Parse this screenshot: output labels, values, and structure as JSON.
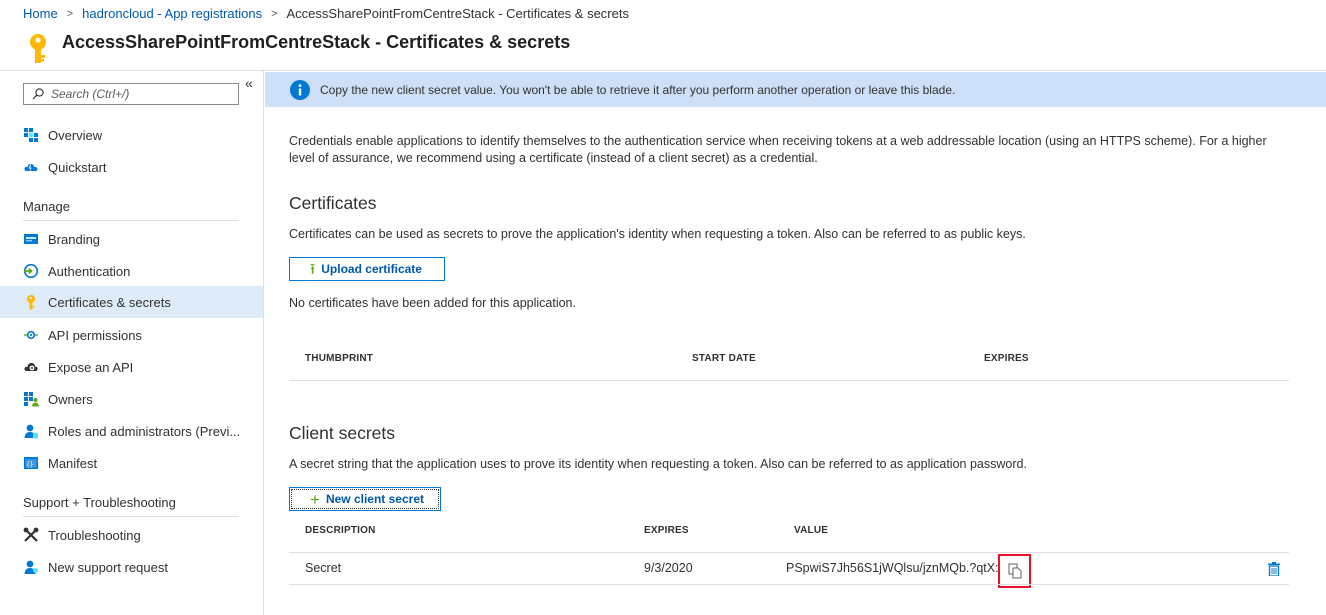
{
  "breadcrumb": {
    "home": "Home",
    "parent": "hadroncloud - App registrations",
    "current": "AccessSharePointFromCentreStack - Certificates & secrets"
  },
  "header": {
    "title": "AccessSharePointFromCentreStack - Certificates & secrets",
    "icon": "key-icon"
  },
  "sidebar": {
    "collapse_glyph": "«",
    "search_placeholder": "Search (Ctrl+/)",
    "items": [
      {
        "label": "Overview",
        "icon": "grid-icon"
      },
      {
        "label": "Quickstart",
        "icon": "cloud-icon"
      }
    ],
    "manage": {
      "heading": "Manage",
      "items": [
        {
          "label": "Branding",
          "icon": "branding-icon"
        },
        {
          "label": "Authentication",
          "icon": "authentication-icon"
        },
        {
          "label": "Certificates & secrets",
          "icon": "key-icon",
          "active": true
        },
        {
          "label": "API permissions",
          "icon": "api-permissions-icon"
        },
        {
          "label": "Expose an API",
          "icon": "cloud-gear-icon"
        },
        {
          "label": "Owners",
          "icon": "owners-icon"
        },
        {
          "label": "Roles and administrators (Previ...",
          "icon": "roles-icon"
        },
        {
          "label": "Manifest",
          "icon": "manifest-icon"
        }
      ]
    },
    "support": {
      "heading": "Support + Troubleshooting",
      "items": [
        {
          "label": "Troubleshooting",
          "icon": "wrench-icon"
        },
        {
          "label": "New support request",
          "icon": "support-person-icon"
        }
      ]
    }
  },
  "main": {
    "info_banner": "Copy the new client secret value. You won't be able to retrieve it after you perform another operation or leave this blade.",
    "intro": "Credentials enable applications to identify themselves to the authentication service when receiving tokens at a web addressable location (using an HTTPS scheme). For a higher level of assurance, we recommend using a certificate (instead of a client secret) as a credential.",
    "certificates": {
      "title": "Certificates",
      "description": "Certificates can be used as secrets to prove the application's identity when requesting a token. Also can be referred to as public keys.",
      "upload_button": "Upload certificate",
      "empty_message": "No certificates have been added for this application.",
      "columns": [
        "THUMBPRINT",
        "START DATE",
        "EXPIRES"
      ]
    },
    "client_secrets": {
      "title": "Client secrets",
      "description": "A secret string that the application uses to prove its identity when requesting a token. Also can be referred to as application password.",
      "new_button": "New client secret",
      "columns": [
        "DESCRIPTION",
        "EXPIRES",
        "VALUE"
      ],
      "rows": [
        {
          "description": "Secret",
          "expires": "9/3/2020",
          "value": "PSpwiS7Jh56S1jWQlsu/jznMQb.?qtX:"
        }
      ]
    }
  },
  "colors": {
    "accent": "#0078d4",
    "link": "#0058ad",
    "info_background": "#cde0f7",
    "active_nav": "#deecf9",
    "highlight_border": "#e81123"
  }
}
